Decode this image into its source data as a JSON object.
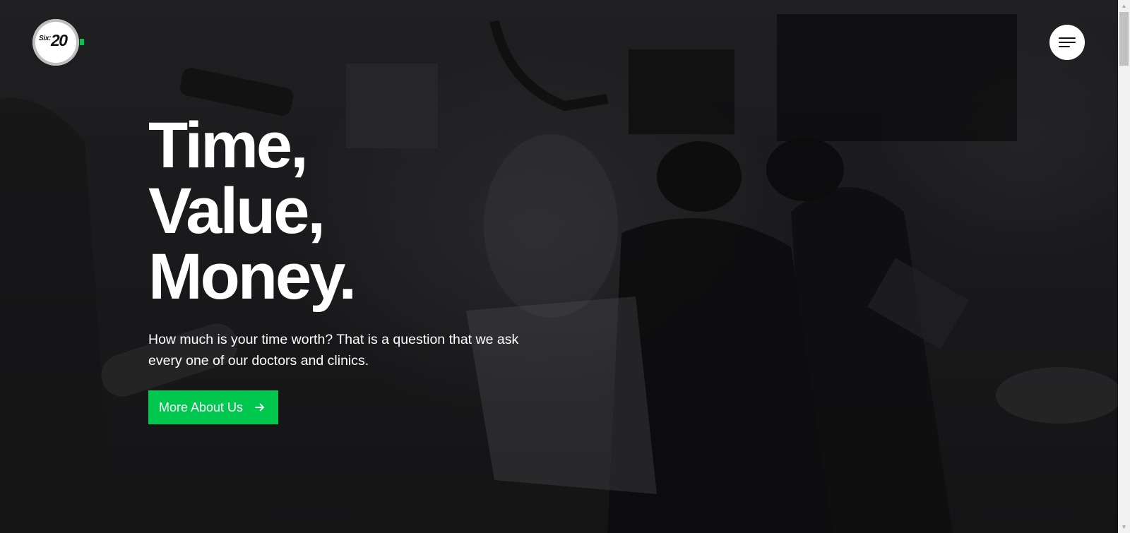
{
  "brand": {
    "logo_prefix": "Six:",
    "logo_number": "20",
    "accent_color": "#00c74e"
  },
  "nav": {
    "menu_icon": "hamburger-menu-icon"
  },
  "hero": {
    "headline": [
      "Time,",
      "Value,",
      "Money."
    ],
    "description": "How much is your time worth? That is a question that we ask every one of our doctors and clinics.",
    "cta_label": "More About Us",
    "cta_icon": "arrow-right-icon"
  },
  "scrollbar": {
    "up_icon": "scroll-up-arrow-icon",
    "down_icon": "scroll-down-arrow-icon"
  }
}
